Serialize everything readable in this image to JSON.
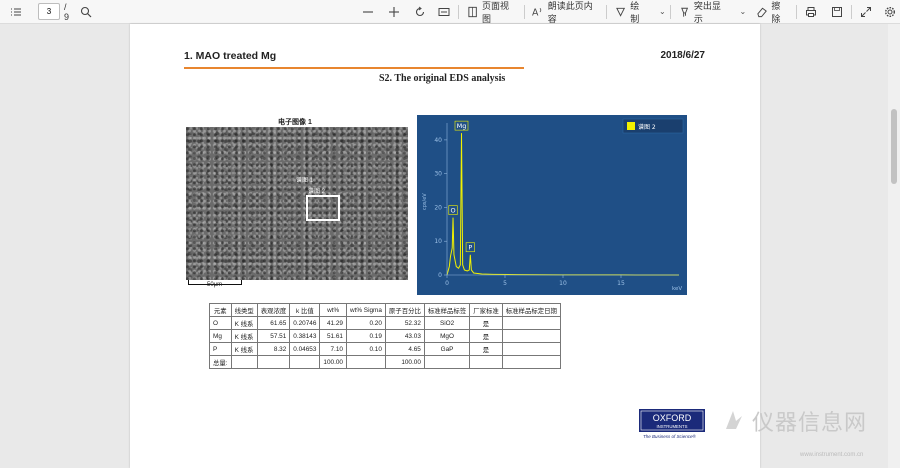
{
  "toolbar": {
    "page_current": "3",
    "page_total": "/ 9",
    "page_view_label": "页面视图",
    "read_aloud_label": "朗读此页内容",
    "draw_label": "绘制",
    "highlight_label": "突出显示",
    "erase_label": "擦除"
  },
  "page": {
    "header_title": "1. MAO treated Mg",
    "header_date": "2018/6/27",
    "section_title": "S2. The original EDS analysis",
    "sem_title": "电子图像 1",
    "sem_label_1": "谱图 1",
    "sem_label_2": "谱图 2",
    "scale_label": "50μm",
    "logo_text_1": "OXFORD",
    "logo_text_2": "INSTRUMENTS",
    "logo_tagline": "The Business of Science®"
  },
  "colors": {
    "accent_orange": "#e8862f",
    "spectrum_bg": "#1f4f86",
    "spectrum_line": "#f2f200",
    "logo_blue": "#1b2a7a"
  },
  "chart_data": {
    "type": "line",
    "legend": "谱图 2",
    "ylabel": "cps/eV",
    "xlabel": "keV",
    "x_ticks": [
      0,
      5,
      10,
      15
    ],
    "y_ticks": [
      0,
      10,
      20,
      30,
      40
    ],
    "xlim": [
      0,
      20
    ],
    "ylim": [
      0,
      45
    ],
    "peaks": [
      {
        "label": "O",
        "x": 0.52,
        "y": 17
      },
      {
        "label": "Mg",
        "x": 1.25,
        "y": 42
      },
      {
        "label": "P",
        "x": 2.01,
        "y": 6
      }
    ],
    "x": [
      0.0,
      0.2,
      0.3,
      0.45,
      0.52,
      0.6,
      0.8,
      1.0,
      1.15,
      1.25,
      1.35,
      1.5,
      1.75,
      1.92,
      2.01,
      2.1,
      2.3,
      3.0,
      4.0,
      6.0,
      10.0,
      15.0,
      20.0
    ],
    "y": [
      0.0,
      2.5,
      5.5,
      8.0,
      17.0,
      6.0,
      2.5,
      2.0,
      3.0,
      42.0,
      3.0,
      1.5,
      1.2,
      1.5,
      6.0,
      1.5,
      0.6,
      0.3,
      0.2,
      0.1,
      0.05,
      0.02,
      0.0
    ]
  },
  "table": {
    "headers": [
      "元素",
      "线类型",
      "表观浓度",
      "k 比值",
      "wt%",
      "wt% Sigma",
      "原子百分比",
      "标准样品标签",
      "厂家标准",
      "标准样品标定日期"
    ],
    "rows": [
      [
        "O",
        "K 线系",
        "61.65",
        "0.20746",
        "41.29",
        "0.20",
        "52.32",
        "SiO2",
        "是",
        ""
      ],
      [
        "Mg",
        "K 线系",
        "57.51",
        "0.38143",
        "51.61",
        "0.19",
        "43.03",
        "MgO",
        "是",
        ""
      ],
      [
        "P",
        "K 线系",
        "8.32",
        "0.04653",
        "7.10",
        "0.10",
        "4.65",
        "GaP",
        "是",
        ""
      ],
      [
        "总量:",
        "",
        "",
        "",
        "100.00",
        "",
        "100.00",
        "",
        "",
        ""
      ]
    ]
  },
  "watermark": {
    "text": "仪器信息网",
    "url": "www.instrument.com.cn"
  }
}
